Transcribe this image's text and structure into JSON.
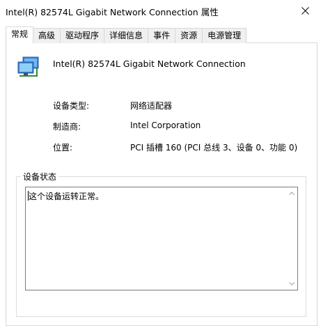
{
  "window": {
    "title": "Intel(R) 82574L Gigabit Network Connection 属性"
  },
  "tabs": [
    {
      "label": "常规",
      "active": true
    },
    {
      "label": "高级",
      "active": false
    },
    {
      "label": "驱动程序",
      "active": false
    },
    {
      "label": "详细信息",
      "active": false
    },
    {
      "label": "事件",
      "active": false
    },
    {
      "label": "资源",
      "active": false
    },
    {
      "label": "电源管理",
      "active": false
    }
  ],
  "general": {
    "device_icon": "network-adapter-icon",
    "device_name": "Intel(R) 82574L Gigabit Network Connection",
    "properties": [
      {
        "label": "设备类型:",
        "value": "网络适配器"
      },
      {
        "label": "制造商:",
        "value": "Intel Corporation"
      },
      {
        "label": "位置:",
        "value": "PCI 插槽 160 (PCI 总线 3、设备 0、功能 0)"
      }
    ],
    "status_group_title": "设备状态",
    "status_text": "这个设备运转正常。"
  },
  "colors": {
    "accent_blue": "#1e90ff",
    "border": "#d9d9d9"
  }
}
